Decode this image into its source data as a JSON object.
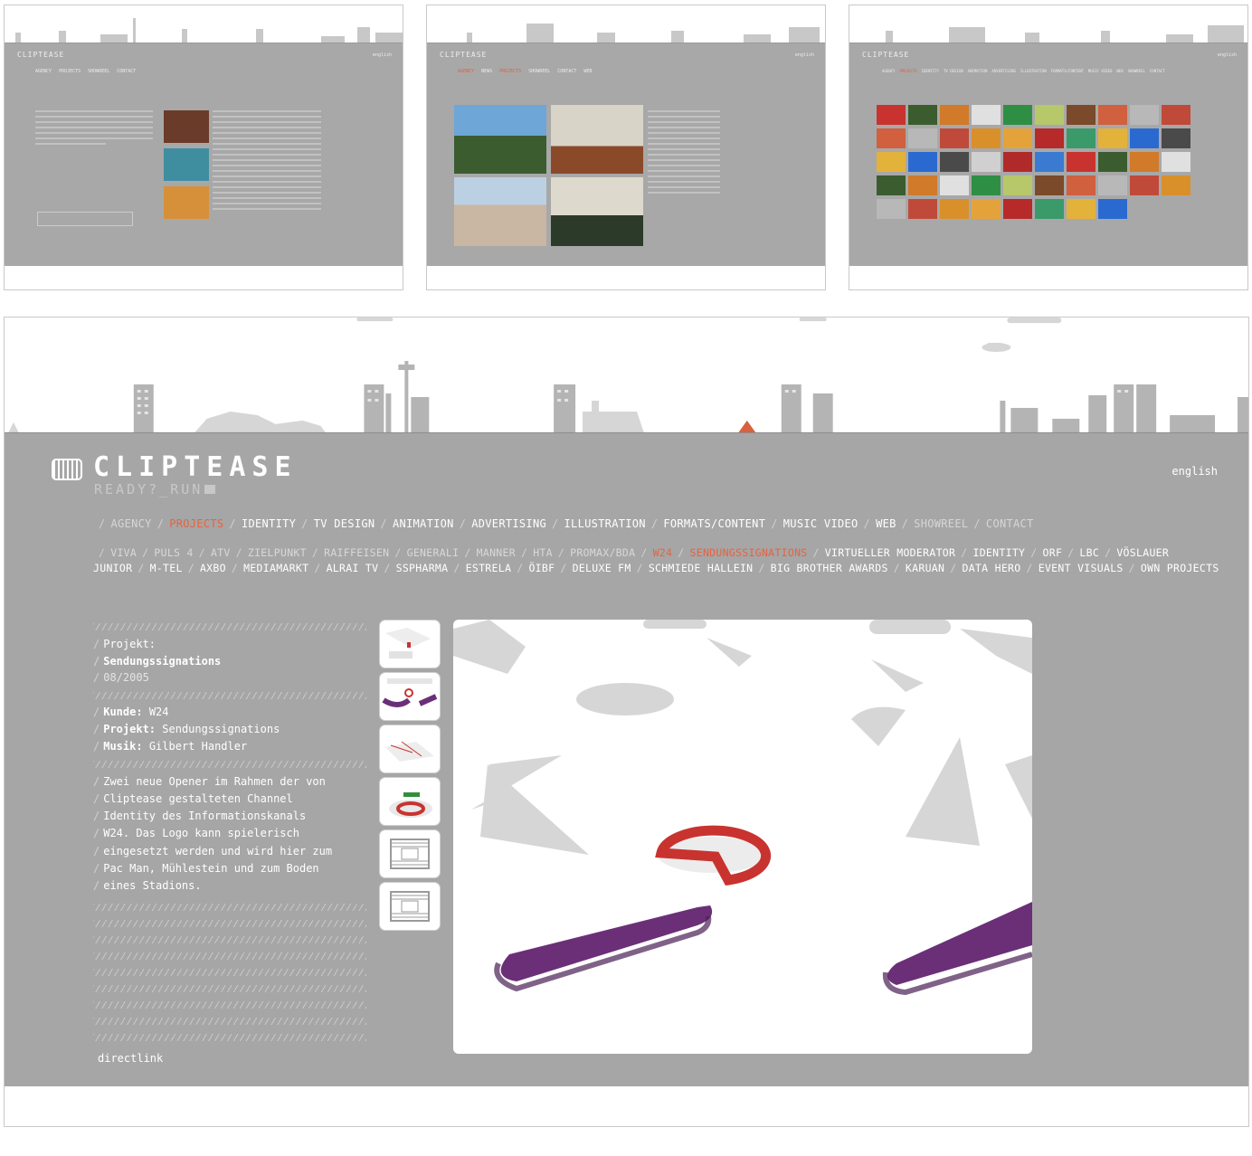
{
  "thumbnails": [
    {
      "logo": "CLIPTEASE",
      "lang": "english",
      "nav": [
        "AGENCY",
        "PROJECTS",
        "SHOWREEL",
        "CONTACT"
      ]
    },
    {
      "logo": "CLIPTEASE",
      "lang": "english",
      "nav": [
        "AGENCY",
        "NEWS",
        "PROJECTS",
        "SHOWREEL",
        "CONTACT",
        "WEB"
      ]
    },
    {
      "logo": "CLIPTEASE",
      "lang": "english",
      "nav": [
        "AGENCY",
        "PROJECTS",
        "IDENTITY",
        "TV DESIGN",
        "ANIMATION",
        "ADVERTISING",
        "ILLUSTRATION",
        "FORMATS/CONTENT",
        "MUSIC VIDEO",
        "WEB",
        "SHOWREEL",
        "CONTACT"
      ]
    }
  ],
  "main": {
    "logo_title": "CLIPTEASE",
    "logo_subtitle": "READY?_RUN",
    "language": "english",
    "nav": [
      {
        "label": "AGENCY",
        "state": "dim"
      },
      {
        "label": "PROJECTS",
        "state": "active"
      },
      {
        "label": "IDENTITY",
        "state": "normal"
      },
      {
        "label": "TV DESIGN",
        "state": "normal"
      },
      {
        "label": "ANIMATION",
        "state": "normal"
      },
      {
        "label": "ADVERTISING",
        "state": "normal"
      },
      {
        "label": "ILLUSTRATION",
        "state": "normal"
      },
      {
        "label": "FORMATS/CONTENT",
        "state": "normal"
      },
      {
        "label": "MUSIC VIDEO",
        "state": "normal"
      },
      {
        "label": "WEB",
        "state": "normal"
      },
      {
        "label": "SHOWREEL",
        "state": "dim"
      },
      {
        "label": "CONTACT",
        "state": "dim"
      }
    ],
    "subnav": [
      {
        "label": "VIVA",
        "state": "dim"
      },
      {
        "label": "PULS 4",
        "state": "dim"
      },
      {
        "label": "ATV",
        "state": "dim"
      },
      {
        "label": "ZIELPUNKT",
        "state": "dim"
      },
      {
        "label": "RAIFFEISEN",
        "state": "dim"
      },
      {
        "label": "GENERALI",
        "state": "dim"
      },
      {
        "label": "MANNER",
        "state": "dim"
      },
      {
        "label": "HTA",
        "state": "dim"
      },
      {
        "label": "PROMAX/BDA",
        "state": "dim"
      },
      {
        "label": "W24",
        "state": "active"
      },
      {
        "label": "SENDUNGSSIGNATIONS",
        "state": "active"
      },
      {
        "label": "VIRTUELLER MODERATOR",
        "state": "normal"
      },
      {
        "label": "IDENTITY",
        "state": "normal"
      },
      {
        "label": "ORF",
        "state": "normal"
      },
      {
        "label": "LBC",
        "state": "normal"
      },
      {
        "label": "VÖSLAUER JUNIOR",
        "state": "normal"
      },
      {
        "label": "M-TEL",
        "state": "normal"
      },
      {
        "label": "AXBO",
        "state": "normal"
      },
      {
        "label": "MEDIAMARKT",
        "state": "normal"
      },
      {
        "label": "ALRAI TV",
        "state": "normal"
      },
      {
        "label": "SSPHARMA",
        "state": "normal"
      },
      {
        "label": "ESTRELA",
        "state": "normal"
      },
      {
        "label": "ÖIBF",
        "state": "normal"
      },
      {
        "label": "DELUXE FM",
        "state": "normal"
      },
      {
        "label": "SCHMIEDE HALLEIN",
        "state": "normal"
      },
      {
        "label": "BIG BROTHER AWARDS",
        "state": "normal"
      },
      {
        "label": "KARUAN",
        "state": "normal"
      },
      {
        "label": "DATA HERO",
        "state": "normal"
      },
      {
        "label": "EVENT VISUALS",
        "state": "normal"
      },
      {
        "label": "OWN PROJECTS",
        "state": "normal"
      }
    ],
    "info": {
      "projekt_label": "Projekt:",
      "projekt_name": "Sendungssignations",
      "date": "08/2005",
      "kunde_label": "Kunde:",
      "kunde_value": "W24",
      "projekt2_label": "Projekt:",
      "projekt2_value": "Sendungssignations",
      "musik_label": "Musik:",
      "musik_value": "Gilbert Handler",
      "description_lines": [
        "Zwei neue Opener im Rahmen der von",
        "Cliptease gestalteten Channel",
        "Identity des Informationskanals",
        "W24. Das Logo kann spielerisch",
        "eingesetzt werden und wird hier zum",
        "Pac Man, Mühlestein und zum Boden",
        "eines Stadions."
      ],
      "directlink": "directlink"
    },
    "colors": {
      "background": "#a6a6a6",
      "accent": "#e8623f",
      "purple": "#6b2f78",
      "red": "#c8332f"
    }
  }
}
